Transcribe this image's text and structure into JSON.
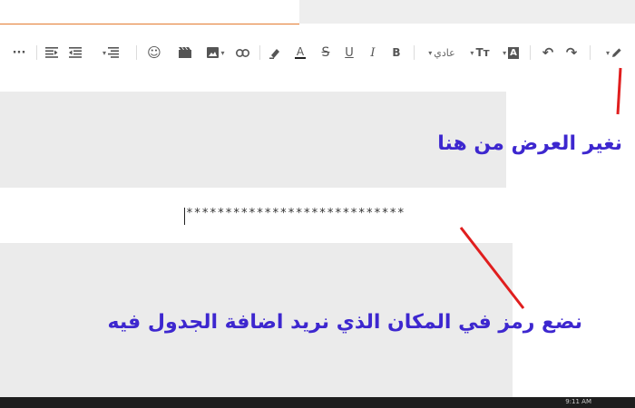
{
  "toolbar": {
    "more_icon": "···",
    "font_label": "عادي",
    "text_size_icon": "Tт",
    "bold_label": "B",
    "italic_label": "I",
    "underline_label": "U",
    "strike_label": "S",
    "color_label": "A",
    "highlight_label": "A"
  },
  "annotations": {
    "change_width": "نغير العرض من هنا",
    "place_symbol": "نضع رمز في المكان الذي نريد اضافة الجدول فيه"
  },
  "editor": {
    "placeholder_symbol": "****************************"
  },
  "status": {
    "clock": "9:11 AM"
  },
  "colors": {
    "annotation_text": "#3d27cf",
    "arrow": "#e01e1e",
    "top_accent": "#e37a2e",
    "panel": "#ebebeb"
  }
}
